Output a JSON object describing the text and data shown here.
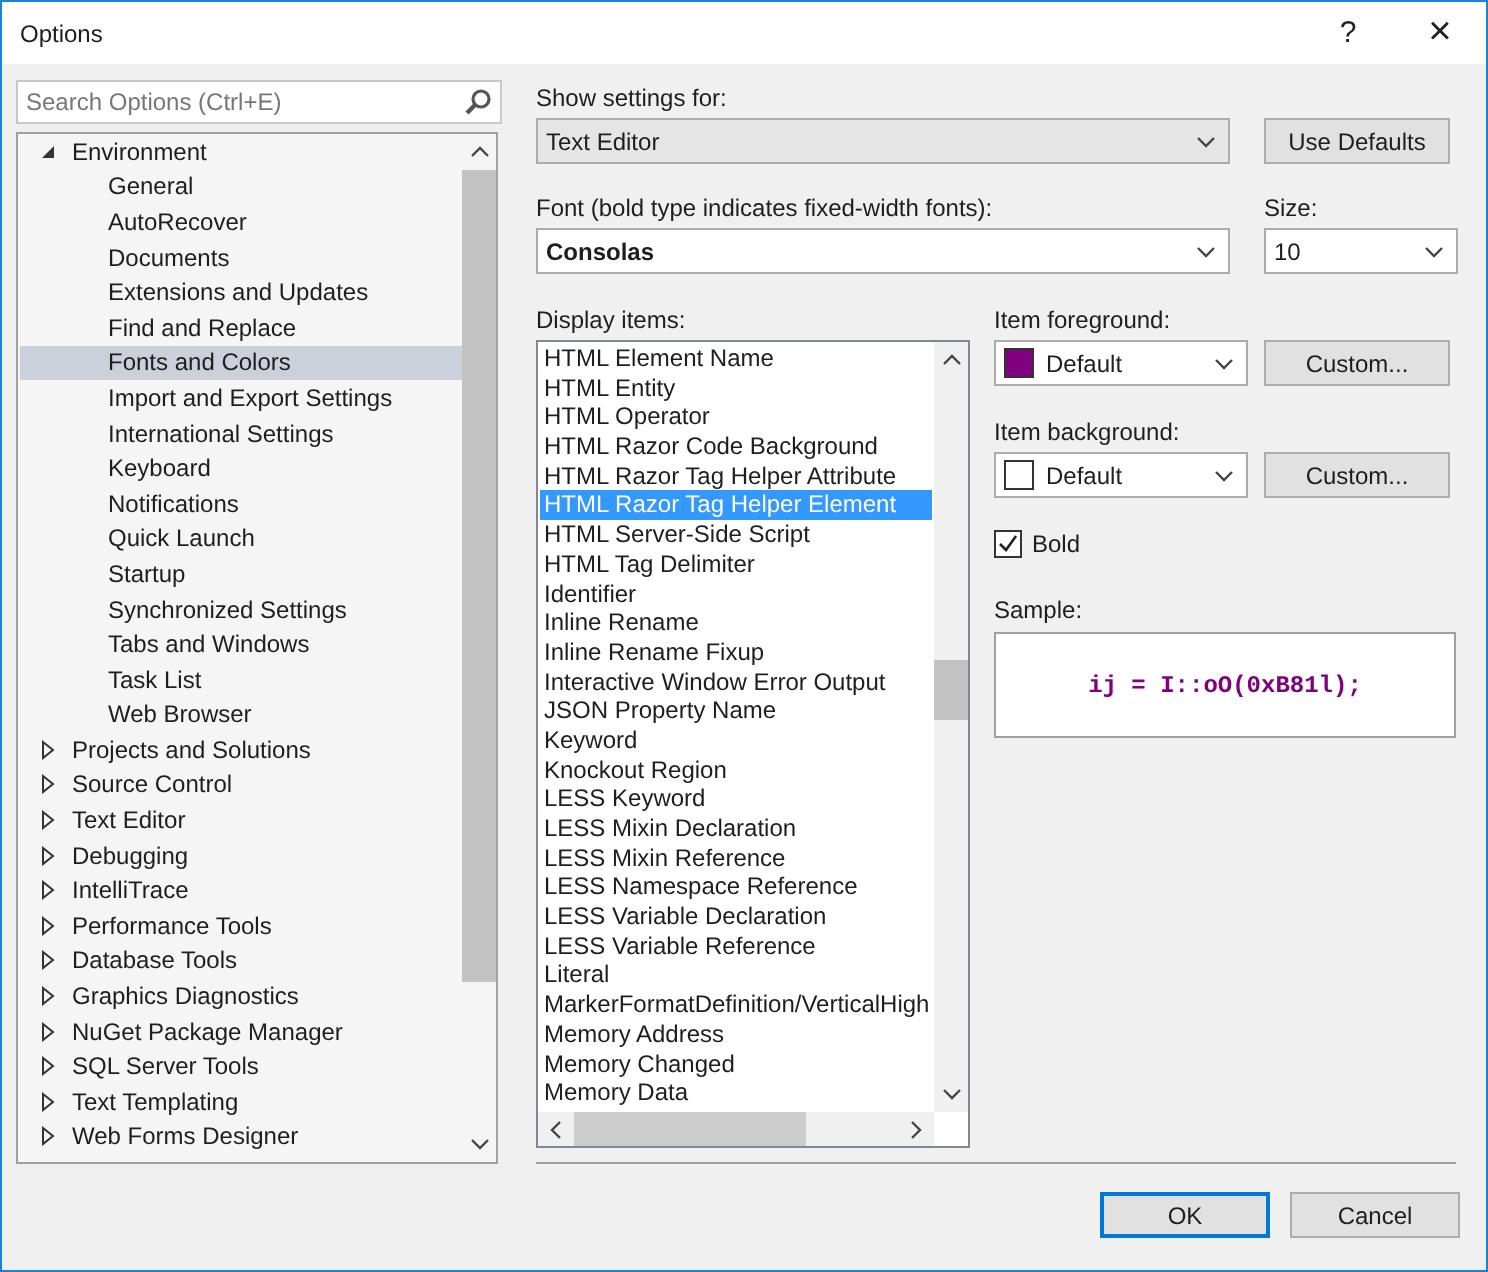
{
  "window": {
    "title": "Options",
    "help": "?",
    "close": "×"
  },
  "search": {
    "placeholder": "Search Options (Ctrl+E)"
  },
  "tree": [
    {
      "label": "Environment",
      "expanded": true,
      "selected": false,
      "children": [
        {
          "label": "General",
          "selected": false
        },
        {
          "label": "AutoRecover",
          "selected": false
        },
        {
          "label": "Documents",
          "selected": false
        },
        {
          "label": "Extensions and Updates",
          "selected": false
        },
        {
          "label": "Find and Replace",
          "selected": false
        },
        {
          "label": "Fonts and Colors",
          "selected": true
        },
        {
          "label": "Import and Export Settings",
          "selected": false
        },
        {
          "label": "International Settings",
          "selected": false
        },
        {
          "label": "Keyboard",
          "selected": false
        },
        {
          "label": "Notifications",
          "selected": false
        },
        {
          "label": "Quick Launch",
          "selected": false
        },
        {
          "label": "Startup",
          "selected": false
        },
        {
          "label": "Synchronized Settings",
          "selected": false
        },
        {
          "label": "Tabs and Windows",
          "selected": false
        },
        {
          "label": "Task List",
          "selected": false
        },
        {
          "label": "Web Browser",
          "selected": false
        }
      ]
    },
    {
      "label": "Projects and Solutions",
      "expanded": false,
      "selected": false
    },
    {
      "label": "Source Control",
      "expanded": false,
      "selected": false
    },
    {
      "label": "Text Editor",
      "expanded": false,
      "selected": false
    },
    {
      "label": "Debugging",
      "expanded": false,
      "selected": false
    },
    {
      "label": "IntelliTrace",
      "expanded": false,
      "selected": false
    },
    {
      "label": "Performance Tools",
      "expanded": false,
      "selected": false
    },
    {
      "label": "Database Tools",
      "expanded": false,
      "selected": false
    },
    {
      "label": "Graphics Diagnostics",
      "expanded": false,
      "selected": false
    },
    {
      "label": "NuGet Package Manager",
      "expanded": false,
      "selected": false
    },
    {
      "label": "SQL Server Tools",
      "expanded": false,
      "selected": false
    },
    {
      "label": "Text Templating",
      "expanded": false,
      "selected": false
    },
    {
      "label": "Web Forms Designer",
      "expanded": false,
      "selected": false
    }
  ],
  "show_settings_for": {
    "label": "Show settings for:",
    "value": "Text Editor"
  },
  "use_defaults_button": "Use Defaults",
  "font": {
    "label": "Font (bold type indicates fixed-width fonts):",
    "value": "Consolas"
  },
  "size": {
    "label": "Size:",
    "value": "10"
  },
  "display_items": {
    "label": "Display items:",
    "items": [
      {
        "label": "HTML Element Name",
        "selected": false
      },
      {
        "label": "HTML Entity",
        "selected": false
      },
      {
        "label": "HTML Operator",
        "selected": false
      },
      {
        "label": "HTML Razor Code Background",
        "selected": false
      },
      {
        "label": "HTML Razor Tag Helper Attribute",
        "selected": false
      },
      {
        "label": "HTML Razor Tag Helper Element",
        "selected": true
      },
      {
        "label": "HTML Server-Side Script",
        "selected": false
      },
      {
        "label": "HTML Tag Delimiter",
        "selected": false
      },
      {
        "label": "Identifier",
        "selected": false
      },
      {
        "label": "Inline Rename",
        "selected": false
      },
      {
        "label": "Inline Rename Fixup",
        "selected": false
      },
      {
        "label": "Interactive Window Error Output",
        "selected": false
      },
      {
        "label": "JSON Property Name",
        "selected": false
      },
      {
        "label": "Keyword",
        "selected": false
      },
      {
        "label": "Knockout Region",
        "selected": false
      },
      {
        "label": "LESS Keyword",
        "selected": false
      },
      {
        "label": "LESS Mixin Declaration",
        "selected": false
      },
      {
        "label": "LESS Mixin Reference",
        "selected": false
      },
      {
        "label": "LESS Namespace Reference",
        "selected": false
      },
      {
        "label": "LESS Variable Declaration",
        "selected": false
      },
      {
        "label": "LESS Variable Reference",
        "selected": false
      },
      {
        "label": "Literal",
        "selected": false
      },
      {
        "label": "MarkerFormatDefinition/VerticalHigh",
        "selected": false
      },
      {
        "label": "Memory Address",
        "selected": false
      },
      {
        "label": "Memory Changed",
        "selected": false
      },
      {
        "label": "Memory Data",
        "selected": false
      }
    ]
  },
  "item_foreground": {
    "label": "Item foreground:",
    "value": "Default",
    "color": "#800080",
    "button": "Custom..."
  },
  "item_background": {
    "label": "Item background:",
    "value": "Default",
    "color": "#ffffff",
    "button": "Custom..."
  },
  "bold": {
    "label": "Bold",
    "checked": true
  },
  "sample": {
    "label": "Sample:",
    "code": "ij = I::oO(0xB81l);"
  },
  "buttons": [
    {
      "label": "OK",
      "default": true
    },
    {
      "label": "Cancel",
      "default": false
    }
  ]
}
